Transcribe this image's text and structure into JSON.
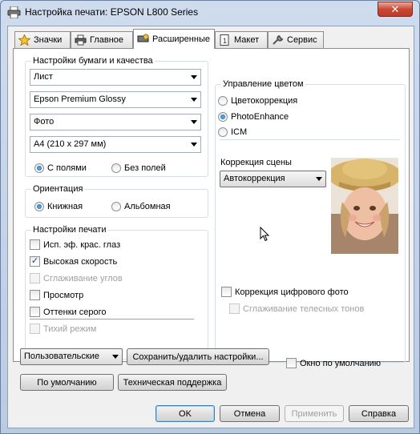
{
  "window": {
    "title": "Настройка печати: EPSON L800 Series",
    "close_glyph": "✕"
  },
  "tabs": [
    {
      "label": "Значки"
    },
    {
      "label": "Главное"
    },
    {
      "label": "Расширенные"
    },
    {
      "label": "Макет"
    },
    {
      "label": "Сервис"
    }
  ],
  "paper": {
    "legend": "Настройки бумаги и качества",
    "source": "Лист",
    "media": "Epson Premium Glossy",
    "quality": "Фото",
    "size": "A4 (210 x 297 мм)",
    "borders": "С полями",
    "borderless": "Без полей"
  },
  "orientation": {
    "legend": "Ориентация",
    "portrait": "Книжная",
    "landscape": "Альбомная"
  },
  "print_settings": {
    "legend": "Настройки печати",
    "items": [
      {
        "label": "Исп. эф. крас. глаз",
        "checked": false,
        "enabled": true
      },
      {
        "label": "Высокая скорость",
        "checked": true,
        "enabled": true
      },
      {
        "label": "Сглаживание углов",
        "checked": false,
        "enabled": false
      },
      {
        "label": "Просмотр",
        "checked": false,
        "enabled": true
      },
      {
        "label": "Оттенки серого",
        "checked": false,
        "enabled": true
      },
      {
        "label": "Тихий режим",
        "checked": false,
        "enabled": false
      }
    ]
  },
  "color": {
    "legend": "Управление цветом",
    "options": [
      "Цветокоррекция",
      "PhotoEnhance",
      "ICM"
    ],
    "selected": "PhotoEnhance",
    "scene_label": "Коррекция сцены",
    "scene_value": "Автокоррекция",
    "digital_fix": "Коррекция цифрового фото",
    "skin_smooth": "Сглаживание телесных тонов"
  },
  "bottom": {
    "preset": "Пользовательские",
    "save_delete": "Сохранить/удалить настройки...",
    "show_default": "Окно по умолчанию",
    "defaults": "По умолчанию",
    "support": "Техническая поддержка"
  },
  "dialog_buttons": {
    "ok": "OK",
    "cancel": "Отмена",
    "apply": "Применить",
    "help": "Справка"
  },
  "icons": [
    "printer-icon",
    "star-icon",
    "printer-tab-icon",
    "advanced-tab-icon",
    "layout-tab-icon",
    "wrench-icon",
    "checkmark-glyph"
  ]
}
